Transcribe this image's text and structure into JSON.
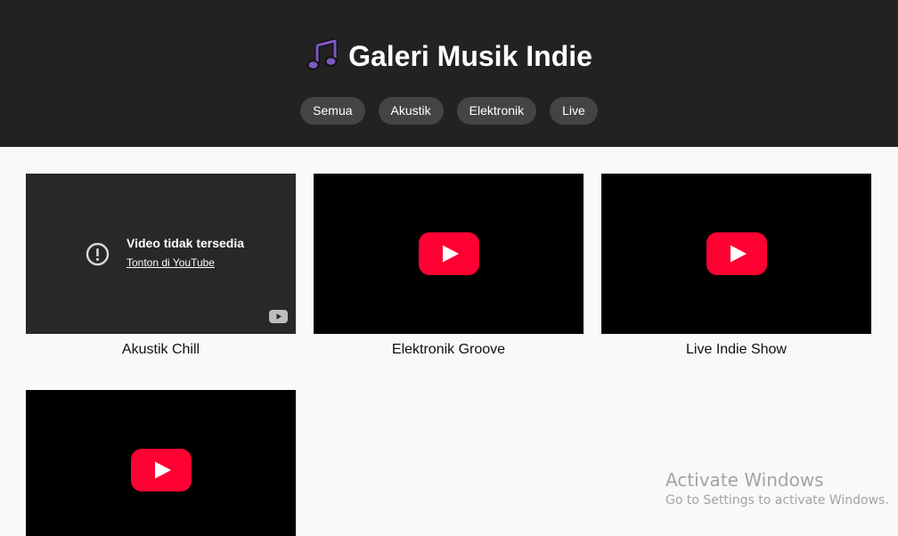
{
  "header": {
    "title": "Galeri Musik Indie",
    "icon": "musical-notes-icon",
    "accent": "#7e57c2"
  },
  "filters": [
    {
      "label": "Semua"
    },
    {
      "label": "Akustik"
    },
    {
      "label": "Elektronik"
    },
    {
      "label": "Live"
    }
  ],
  "videos": [
    {
      "title": "Akustik Chill",
      "status": "unavailable",
      "error_title": "Video tidak tersedia",
      "error_link": "Tonton di YouTube"
    },
    {
      "title": "Elektronik Groove",
      "status": "playable"
    },
    {
      "title": "Live Indie Show",
      "status": "playable"
    },
    {
      "title": "",
      "status": "playable"
    }
  ],
  "colors": {
    "header_bg": "#222222",
    "filter_bg": "#444444",
    "page_bg": "#f9f9f9",
    "youtube_red": "#ff0033"
  },
  "watermark": {
    "title": "Activate Windows",
    "subtitle": "Go to Settings to activate Windows."
  }
}
